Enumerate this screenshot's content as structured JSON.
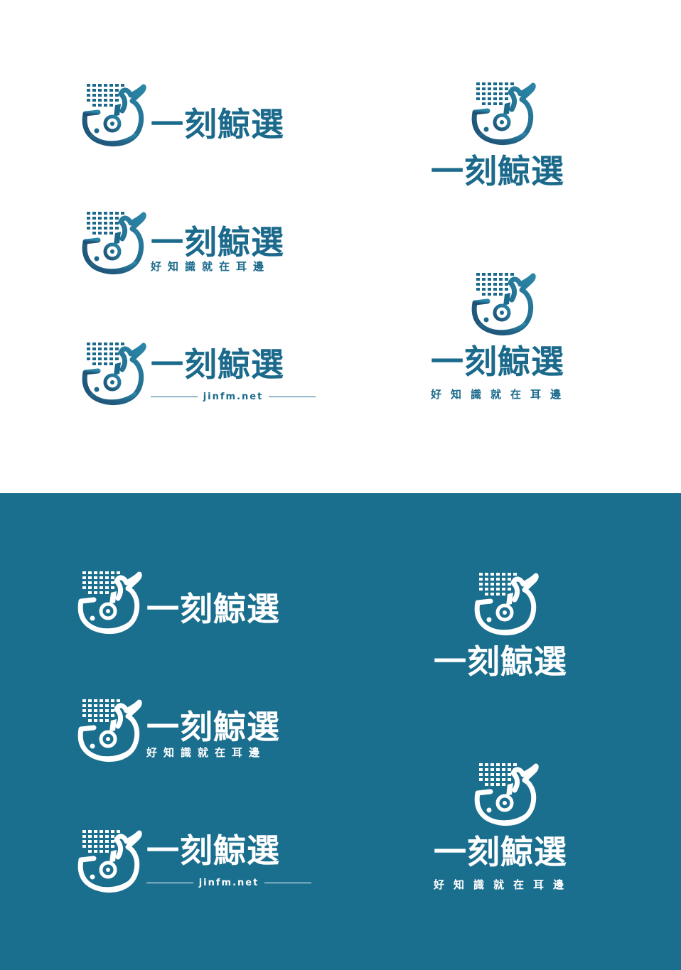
{
  "brand": {
    "name": "一刻鯨選",
    "slogan": "好知識就在耳邊",
    "url": "jinfm.net"
  },
  "colors": {
    "light_background": "#ffffff",
    "dark_background": "#1a6e8e",
    "logo_primary": "#1b6a8c",
    "logo_gradient_dark": "#1e4f73",
    "logo_gradient_light": "#2a87a8",
    "logo_on_dark": "#ffffff"
  },
  "icons": {
    "mark": "whale-with-headphones-icon",
    "equalizer": "sound-bars-icon"
  },
  "variants_light": [
    {
      "layout": "horizontal",
      "sub": "none"
    },
    {
      "layout": "horizontal",
      "sub": "slogan"
    },
    {
      "layout": "horizontal",
      "sub": "url"
    },
    {
      "layout": "stacked",
      "sub": "none"
    },
    {
      "layout": "stacked",
      "sub": "slogan"
    }
  ],
  "variants_dark": [
    {
      "layout": "horizontal",
      "sub": "none"
    },
    {
      "layout": "horizontal",
      "sub": "slogan"
    },
    {
      "layout": "horizontal",
      "sub": "url"
    },
    {
      "layout": "stacked",
      "sub": "none"
    },
    {
      "layout": "stacked",
      "sub": "slogan"
    }
  ]
}
